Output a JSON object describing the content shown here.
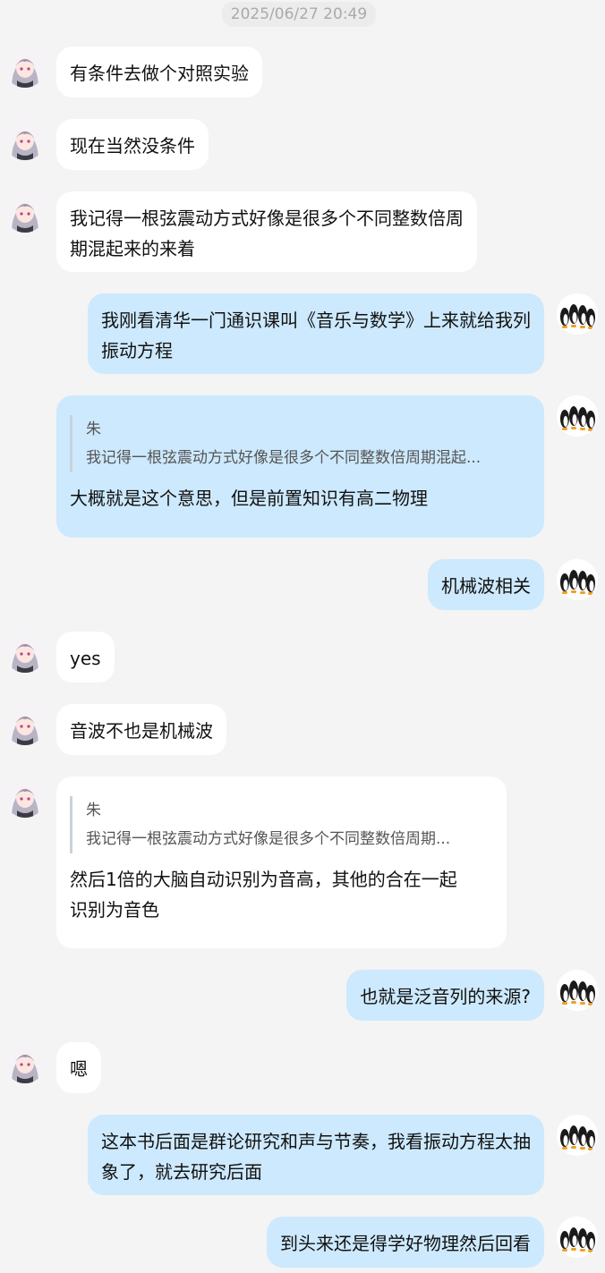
{
  "chat": {
    "timestamp": "2025/06/27 20:49",
    "messages": [
      {
        "from": "other",
        "lines": [
          "有条件去做个对照实验"
        ]
      },
      {
        "from": "other",
        "lines": [
          "现在当然没条件"
        ]
      },
      {
        "from": "other",
        "lines": [
          "我记得一根弦震动方式好像是很多个不同整数倍周",
          "期混起来的来着"
        ]
      },
      {
        "from": "me",
        "lines": [
          "我刚看清华一门通识课叫《音乐与数学》上来就给我列",
          "振动方程"
        ]
      },
      {
        "from": "me",
        "quote": {
          "sender": "朱",
          "text": "我记得一根弦震动方式好像是很多个不同整数倍周期混起..."
        },
        "lines": [
          "大概就是这个意思，但是前置知识有高二物理"
        ]
      },
      {
        "from": "me",
        "lines": [
          "机械波相关"
        ]
      },
      {
        "from": "other",
        "lines": [
          "yes"
        ]
      },
      {
        "from": "other",
        "lines": [
          "音波不也是机械波"
        ]
      },
      {
        "from": "other",
        "quote": {
          "sender": "朱",
          "text": "我记得一根弦震动方式好像是很多个不同整数倍周期..."
        },
        "lines": [
          "然后1倍的大脑自动识别为音高，其他的合在一起",
          "识别为音色"
        ]
      },
      {
        "from": "me",
        "lines": [
          "也就是泛音列的来源?"
        ]
      },
      {
        "from": "other",
        "lines": [
          "嗯"
        ]
      },
      {
        "from": "me",
        "lines": [
          "这本书后面是群论研究和声与节奏，我看振动方程太抽",
          "象了，就去研究后面"
        ]
      },
      {
        "from": "me",
        "lines": [
          "到头来还是得学好物理然后回看"
        ]
      }
    ]
  }
}
